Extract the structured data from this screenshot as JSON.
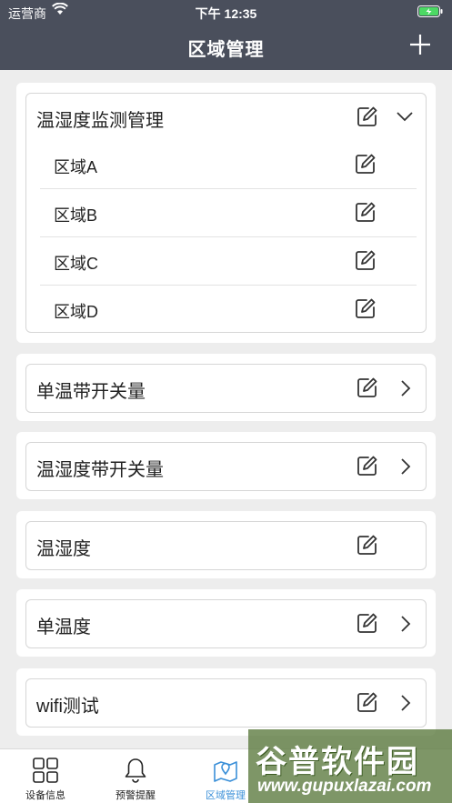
{
  "status_bar": {
    "carrier": "运营商",
    "time": "下午 12:35"
  },
  "nav": {
    "title": "区域管理"
  },
  "groups": [
    {
      "title": "温湿度监测管理",
      "expanded": true,
      "children": [
        "区域A",
        "区域B",
        "区域C",
        "区域D"
      ]
    },
    {
      "title": "单温带开关量",
      "expanded": false,
      "children": []
    },
    {
      "title": "温湿度带开关量",
      "expanded": false,
      "children": []
    },
    {
      "title": "温湿度",
      "expanded": false,
      "children": []
    },
    {
      "title": "单温度",
      "expanded": false,
      "children": []
    },
    {
      "title": "wifi测试",
      "expanded": false,
      "children": []
    }
  ],
  "tabs": [
    {
      "label": "设备信息",
      "icon": "grid-icon"
    },
    {
      "label": "预警提醒",
      "icon": "bell-icon"
    },
    {
      "label": "区域管理",
      "icon": "map-pin-icon",
      "active": true
    }
  ],
  "watermark": {
    "main": "谷普软件园",
    "url": "www.gupuxlazai.com"
  },
  "colors": {
    "nav_background": "#4a4f5c",
    "page_background": "#ededed",
    "active_tab": "#3a8fd8",
    "battery": "#4cd964"
  }
}
